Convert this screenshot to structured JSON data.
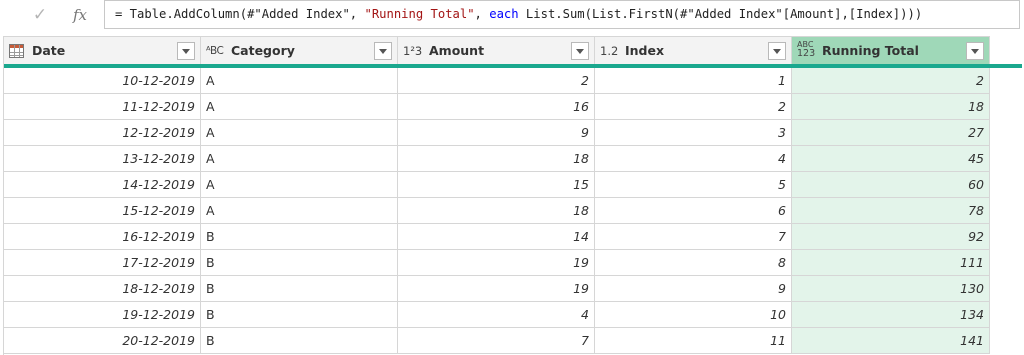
{
  "formula": {
    "check_glyph": "✓",
    "fx_label": "fx",
    "seg1": "= Table.AddColumn(#\"Added Index\", ",
    "seg2": "\"Running Total\"",
    "seg3": ", ",
    "seg4": "each",
    "seg5": " List.Sum(List.FirstN(#\"Added Index\"[Amount],[Index])))"
  },
  "columns": [
    {
      "label": "Date",
      "type_icon": "table-icon"
    },
    {
      "label": "Category",
      "type_icon": "ABC"
    },
    {
      "label": "Amount",
      "type_icon": "123"
    },
    {
      "label": "Index",
      "type_icon": "1.2"
    },
    {
      "label": "Running Total",
      "type_icon": "ABC/123"
    }
  ],
  "type_icons": {
    "text": "ᴬBC",
    "whole": "1²3",
    "decimal": "1.2",
    "any_top": "ABC",
    "any_bottom": "123"
  },
  "rows": [
    {
      "date": "10-12-2019",
      "category": "A",
      "amount": "2",
      "index": "1",
      "running_total": "2"
    },
    {
      "date": "11-12-2019",
      "category": "A",
      "amount": "16",
      "index": "2",
      "running_total": "18"
    },
    {
      "date": "12-12-2019",
      "category": "A",
      "amount": "9",
      "index": "3",
      "running_total": "27"
    },
    {
      "date": "13-12-2019",
      "category": "A",
      "amount": "18",
      "index": "4",
      "running_total": "45"
    },
    {
      "date": "14-12-2019",
      "category": "A",
      "amount": "15",
      "index": "5",
      "running_total": "60"
    },
    {
      "date": "15-12-2019",
      "category": "A",
      "amount": "18",
      "index": "6",
      "running_total": "78"
    },
    {
      "date": "16-12-2019",
      "category": "B",
      "amount": "14",
      "index": "7",
      "running_total": "92"
    },
    {
      "date": "17-12-2019",
      "category": "B",
      "amount": "19",
      "index": "8",
      "running_total": "111"
    },
    {
      "date": "18-12-2019",
      "category": "B",
      "amount": "19",
      "index": "9",
      "running_total": "130"
    },
    {
      "date": "19-12-2019",
      "category": "B",
      "amount": "4",
      "index": "10",
      "running_total": "134"
    },
    {
      "date": "20-12-2019",
      "category": "B",
      "amount": "7",
      "index": "11",
      "running_total": "141"
    }
  ],
  "colors": {
    "accent_bar": "#1aa88e",
    "selected_header": "#9fd8b8",
    "selected_cell": "#e3f4ea",
    "string_token": "#a31515",
    "keyword_token": "#0000ff"
  }
}
